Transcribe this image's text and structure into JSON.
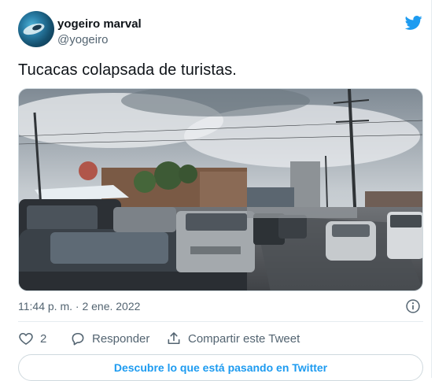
{
  "author": {
    "name": "yogeiro marval",
    "handle": "@yogeiro"
  },
  "tweet": {
    "text": "Tucacas colapsada de turistas.",
    "timestamp": "11:44 p. m. · 2 ene. 2022"
  },
  "actions": {
    "like_count": "2",
    "reply_label": "Responder",
    "share_label": "Compartir este Tweet"
  },
  "cta_label": "Descubre lo que está pasando en Twitter",
  "icons": {
    "brand": "twitter-bird-icon",
    "info": "info-icon",
    "like": "heart-icon",
    "reply": "reply-icon",
    "share": "share-icon"
  },
  "colors": {
    "brand": "#1d9bf0",
    "text": "#0f1419",
    "secondary": "#536471",
    "border": "#cfd9de"
  }
}
